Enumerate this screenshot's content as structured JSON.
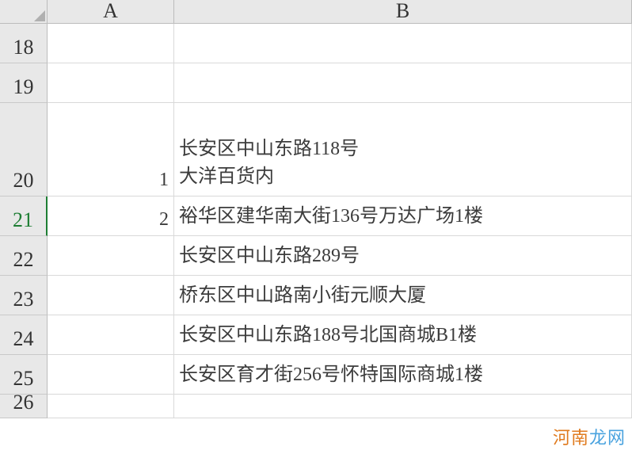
{
  "columns": [
    "A",
    "B"
  ],
  "rows": [
    {
      "num": "18",
      "a": "",
      "b": "",
      "height": "h-normal",
      "selected": false
    },
    {
      "num": "19",
      "a": "",
      "b": "",
      "height": "h-normal",
      "selected": false
    },
    {
      "num": "20",
      "a": "1",
      "b": "长安区中山东路118号\n大洋百货内",
      "height": "h-tall",
      "selected": false
    },
    {
      "num": "21",
      "a": "2",
      "b": "裕华区建华南大街136号万达广场1楼",
      "height": "h-normal",
      "selected": true
    },
    {
      "num": "22",
      "a": "",
      "b": "长安区中山东路289号",
      "height": "h-normal",
      "selected": false
    },
    {
      "num": "23",
      "a": "",
      "b": "桥东区中山路南小街元顺大厦",
      "height": "h-normal",
      "selected": false
    },
    {
      "num": "24",
      "a": "",
      "b": "长安区中山东路188号北国商城B1楼",
      "height": "h-normal",
      "selected": false
    },
    {
      "num": "25",
      "a": "",
      "b": "长安区育才街256号怀特国际商城1楼",
      "height": "h-normal",
      "selected": false
    },
    {
      "num": "26",
      "a": "",
      "b": "",
      "height": "h-last",
      "selected": false
    }
  ],
  "watermark": {
    "part1": "河南",
    "part2": "龙网"
  }
}
